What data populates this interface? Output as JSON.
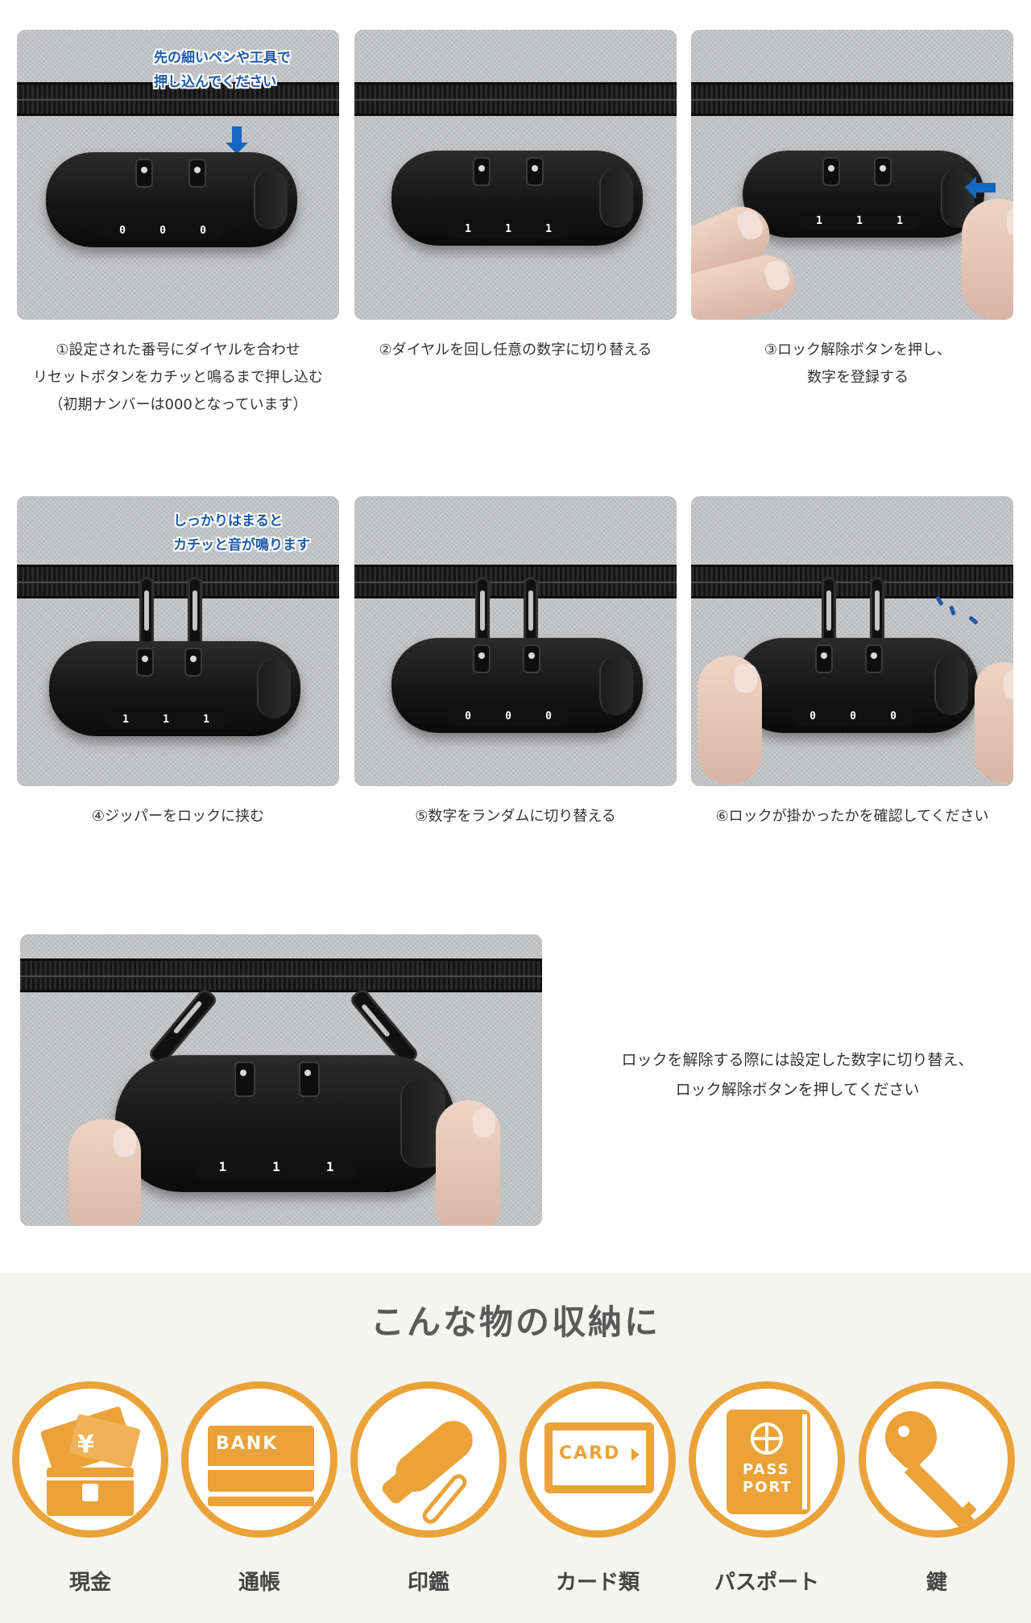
{
  "steps": [
    {
      "number": "1",
      "callout_lines": [
        "先の細いペンや工具で",
        "押し込んでください"
      ],
      "dials": [
        "0",
        "0",
        "0"
      ],
      "caption_lines": [
        "①設定された番号にダイヤルを合わせ",
        "リセットボタンをカチッと鳴るまで押し込む",
        "（初期ナンバーは000となっています）"
      ]
    },
    {
      "number": "2",
      "dials": [
        "1",
        "1",
        "1"
      ],
      "caption_lines": [
        "②ダイヤルを回し任意の数字に切り替える"
      ]
    },
    {
      "number": "3",
      "dials": [
        "1",
        "1",
        "1"
      ],
      "caption_lines": [
        "③ロック解除ボタンを押し、",
        "数字を登録する"
      ]
    },
    {
      "number": "4",
      "callout_lines": [
        "しっかりはまると",
        "カチッと音が鳴ります"
      ],
      "dials": [
        "1",
        "1",
        "1"
      ],
      "caption_lines": [
        "④ジッパーをロックに挟む"
      ]
    },
    {
      "number": "5",
      "dials": [
        "0",
        "0",
        "0"
      ],
      "caption_lines": [
        "⑤数字をランダムに切り替える"
      ]
    },
    {
      "number": "6",
      "dials": [
        "0",
        "0",
        "0"
      ],
      "caption_lines": [
        "⑥ロックが掛かったかを確認してください"
      ]
    }
  ],
  "unlock": {
    "dials": [
      "1",
      "1",
      "1"
    ],
    "text_lines": [
      "ロックを解除する際には設定した数字に切り替え、",
      "ロック解除ボタンを押してください"
    ]
  },
  "storage": {
    "title": "こんな物の収納に",
    "accent_color": "#eba238",
    "items": [
      {
        "label": "現金",
        "icon": "cash-icon",
        "icon_text": "¥"
      },
      {
        "label": "通帳",
        "icon": "bankbook-icon",
        "icon_text": "BANK"
      },
      {
        "label": "印鑑",
        "icon": "seal-stamp-icon"
      },
      {
        "label": "カード類",
        "icon": "card-icon",
        "icon_text": "CARD"
      },
      {
        "label": "パスポート",
        "icon": "passport-icon",
        "icon_text_lines": [
          "PASS",
          "PORT"
        ]
      },
      {
        "label": "鍵",
        "icon": "key-icon"
      }
    ]
  }
}
